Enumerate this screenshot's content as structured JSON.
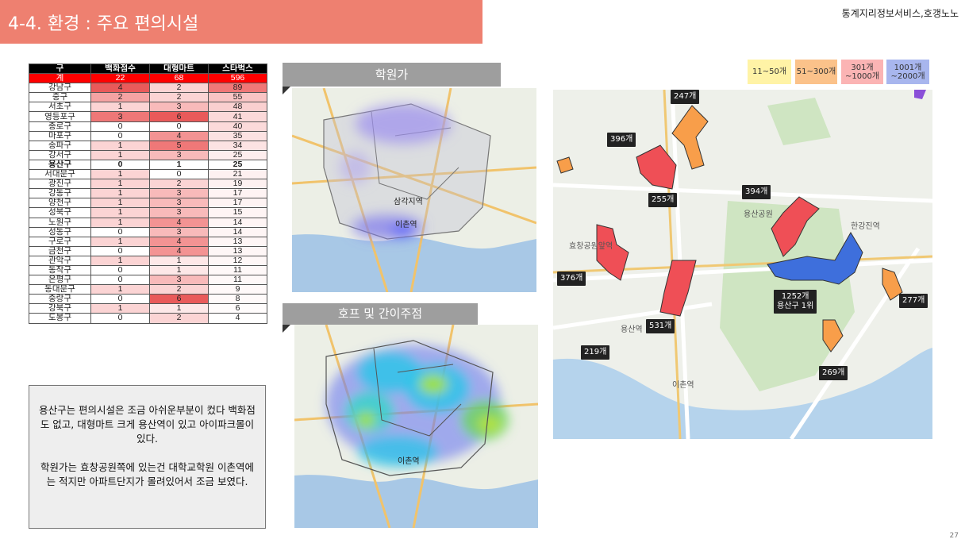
{
  "header": {
    "title": "4-4. 환경 : 주요 편의시설",
    "source": "통계지리정보서비스,호갱노노",
    "page_number": "27"
  },
  "table": {
    "columns": [
      "구",
      "백화점수",
      "대형마트",
      "스타벅스"
    ],
    "rows": [
      {
        "name": "계",
        "dept": "22",
        "mart": "68",
        "sb": "596",
        "kind": "total"
      },
      {
        "name": "강남구",
        "dept": "4",
        "mart": "2",
        "sb": "89",
        "c": [
          "#e95a5a",
          "#fbd4d4",
          "#f07777"
        ]
      },
      {
        "name": "중구",
        "dept": "2",
        "mart": "2",
        "sb": "55",
        "c": [
          "#f5a3a3",
          "#fbd4d4",
          "#f9c4c4"
        ]
      },
      {
        "name": "서초구",
        "dept": "1",
        "mart": "3",
        "sb": "48",
        "c": [
          "#fbd4d4",
          "#f8baba",
          "#fad0d0"
        ]
      },
      {
        "name": "영등포구",
        "dept": "3",
        "mart": "6",
        "sb": "41",
        "c": [
          "#ee7777",
          "#e95a5a",
          "#fbd9d9"
        ]
      },
      {
        "name": "종로구",
        "dept": "0",
        "mart": "0",
        "sb": "40",
        "c": [
          "#ffffff",
          "#ffffff",
          "#fbdada"
        ]
      },
      {
        "name": "마포구",
        "dept": "0",
        "mart": "4",
        "sb": "35",
        "c": [
          "#ffffff",
          "#f39393",
          "#fce2e2"
        ]
      },
      {
        "name": "송파구",
        "dept": "1",
        "mart": "5",
        "sb": "34",
        "c": [
          "#fbd4d4",
          "#ef7878",
          "#fce3e3"
        ]
      },
      {
        "name": "강서구",
        "dept": "1",
        "mart": "3",
        "sb": "25",
        "c": [
          "#fbd4d4",
          "#f8baba",
          "#fdeded"
        ]
      },
      {
        "name": "용산구",
        "dept": "0",
        "mart": "1",
        "sb": "25",
        "kind": "bold",
        "c": [
          "#ffffff",
          "#ffffff",
          "#ffffff"
        ]
      },
      {
        "name": "서대문구",
        "dept": "1",
        "mart": "0",
        "sb": "21",
        "c": [
          "#fbd4d4",
          "#ffffff",
          "#fdf0f0"
        ]
      },
      {
        "name": "광진구",
        "dept": "1",
        "mart": "2",
        "sb": "19",
        "c": [
          "#fbd4d4",
          "#fbd4d4",
          "#fdf1f1"
        ]
      },
      {
        "name": "강동구",
        "dept": "1",
        "mart": "3",
        "sb": "17",
        "c": [
          "#fbd4d4",
          "#f8baba",
          "#fef3f3"
        ]
      },
      {
        "name": "양천구",
        "dept": "1",
        "mart": "3",
        "sb": "17",
        "c": [
          "#fbd4d4",
          "#f8baba",
          "#fef3f3"
        ]
      },
      {
        "name": "성북구",
        "dept": "1",
        "mart": "3",
        "sb": "15",
        "c": [
          "#fbd4d4",
          "#f8baba",
          "#fef4f4"
        ]
      },
      {
        "name": "노원구",
        "dept": "1",
        "mart": "4",
        "sb": "14",
        "c": [
          "#fbd4d4",
          "#f39393",
          "#fef5f5"
        ]
      },
      {
        "name": "성동구",
        "dept": "0",
        "mart": "3",
        "sb": "14",
        "c": [
          "#ffffff",
          "#f8baba",
          "#fef5f5"
        ]
      },
      {
        "name": "구로구",
        "dept": "1",
        "mart": "4",
        "sb": "13",
        "c": [
          "#fbd4d4",
          "#f39393",
          "#fef6f6"
        ]
      },
      {
        "name": "금천구",
        "dept": "0",
        "mart": "4",
        "sb": "13",
        "c": [
          "#ffffff",
          "#f39393",
          "#fef6f6"
        ]
      },
      {
        "name": "관악구",
        "dept": "1",
        "mart": "1",
        "sb": "12",
        "c": [
          "#fbd4d4",
          "#fde8e8",
          "#fef7f7"
        ]
      },
      {
        "name": "동작구",
        "dept": "0",
        "mart": "1",
        "sb": "11",
        "c": [
          "#ffffff",
          "#fde8e8",
          "#fef8f8"
        ]
      },
      {
        "name": "은평구",
        "dept": "0",
        "mart": "3",
        "sb": "11",
        "c": [
          "#ffffff",
          "#f8baba",
          "#fef8f8"
        ]
      },
      {
        "name": "동대문구",
        "dept": "1",
        "mart": "2",
        "sb": "9",
        "c": [
          "#fbd4d4",
          "#fbd4d4",
          "#fff9f9"
        ]
      },
      {
        "name": "중랑구",
        "dept": "0",
        "mart": "6",
        "sb": "8",
        "c": [
          "#ffffff",
          "#e95a5a",
          "#fffafa"
        ]
      },
      {
        "name": "강북구",
        "dept": "1",
        "mart": "1",
        "sb": "6",
        "c": [
          "#fbd4d4",
          "#fde8e8",
          "#fffcfc"
        ]
      },
      {
        "name": "도봉구",
        "dept": "0",
        "mart": "2",
        "sb": "4",
        "c": [
          "#ffffff",
          "#fbd4d4",
          "#ffffff"
        ]
      }
    ]
  },
  "note": {
    "para1": "용산구는 편의시설은 조금 아쉬운부분이 컸다 백화점도 없고, 대형마트 크게 용산역이 있고 아이파크몰이 있다.",
    "para2": "학원가는 효창공원쪽에 있는건 대학교학원 이촌역에는 적지만 아파트단지가 몰려있어서 조금 보였다."
  },
  "maps": {
    "academy_label": "학원가",
    "pub_label": "호프 및 간이주점",
    "map_texts": {
      "samgakji": "삼각지역",
      "ichon": "이촌역",
      "yongsan_station": "용산역",
      "hangangjin": "한강진역",
      "yongsan_park": "용산공원",
      "hyochang": "효창공원앞역"
    }
  },
  "legend": [
    {
      "label": "11~50개",
      "color": "#fff3a6"
    },
    {
      "label": "51~300개",
      "color": "#fbc28a"
    },
    {
      "label": "301개\n~1000개",
      "color": "#fbb4b4"
    },
    {
      "label": "1001개\n~2000개",
      "color": "#a8b6ee"
    }
  ],
  "counts": [
    {
      "label": "247개"
    },
    {
      "label": "396개"
    },
    {
      "label": "255개"
    },
    {
      "label": "394개"
    },
    {
      "label": "376개"
    },
    {
      "label": "1252개\n용산구 1위"
    },
    {
      "label": "277개"
    },
    {
      "label": "531개"
    },
    {
      "label": "219개"
    },
    {
      "label": "269개"
    }
  ]
}
